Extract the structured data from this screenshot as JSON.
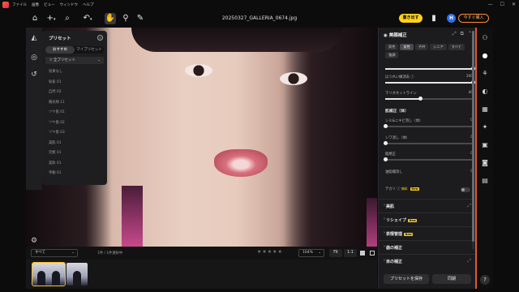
{
  "menubar": {
    "items": [
      "ファイル",
      "画像",
      "ビュー",
      "ウィンドウ",
      "ヘルプ"
    ],
    "win": [
      "—",
      "☐",
      "✕"
    ]
  },
  "toolbar": {
    "filename": "20250327_GALLERIA_0674.jpg",
    "export_label": "書き出す",
    "buy_label": "今すぐ購入",
    "user_initial": "H"
  },
  "preset_panel": {
    "title": "プリセット",
    "tabs": [
      "おすすめ",
      "マイプリセット"
    ],
    "active_tab": 0,
    "select_value": "全プリセット",
    "items": [
      "効果なし",
      "垢抜 01",
      "自然 02",
      "陽光映 11",
      "ツヤ肌 01",
      "ツヤ肌 02",
      "ツヤ肌 03",
      "美肌 01",
      "究極 01",
      "美妝 01",
      "手動 01"
    ]
  },
  "bottombar": {
    "filter_value": "すべて",
    "count_text": "1件 / 1件選択中",
    "stars": "★★★★★",
    "zoom_value": "104%",
    "fit_label": "Fit",
    "one_label": "1:1"
  },
  "right_panel": {
    "title": "美顔補正",
    "chips": [
      "男性",
      "女性",
      "子供",
      "シニア",
      "すべて",
      "強調"
    ],
    "active_chip": 1,
    "sliders": [
      {
        "label": "",
        "value": "",
        "pct": 1.0
      },
      {
        "label": "ほうれい線消去 ⓘ",
        "value": "100",
        "pct": 1.0
      },
      {
        "label": "マリオネットライン",
        "value": "40",
        "pct": 0.4
      }
    ],
    "skin_head": "肌補正（体）",
    "skin_sliders": [
      {
        "label": "シミ&ニキビ消し（体）",
        "value": "0",
        "pct": 0
      },
      {
        "label": "シワ消し（体）",
        "value": "0",
        "pct": 0
      },
      {
        "label": "脂焼正",
        "value": "0",
        "pct": 0
      },
      {
        "label": "油脂補消し",
        "value": "0",
        "pct": 0
      }
    ],
    "glare_label": "テカリ",
    "glare_badge_1": "無料",
    "glare_badge_2": "New",
    "sections": [
      {
        "label": "美肌",
        "badge": ""
      },
      {
        "label": "リシェイプ",
        "badge": "New"
      },
      {
        "label": "表情管理",
        "badge": "New"
      },
      {
        "label": "歯の補正",
        "badge": ""
      },
      {
        "label": "目の補正",
        "badge": ""
      }
    ],
    "save_label": "プリセットを保存",
    "sync_label": "同期"
  },
  "colors": {
    "accent": "#ffd21a",
    "buy_border": "#ff8a3c",
    "user": "#2f6fe6",
    "panel_edge": "#e4572e"
  }
}
